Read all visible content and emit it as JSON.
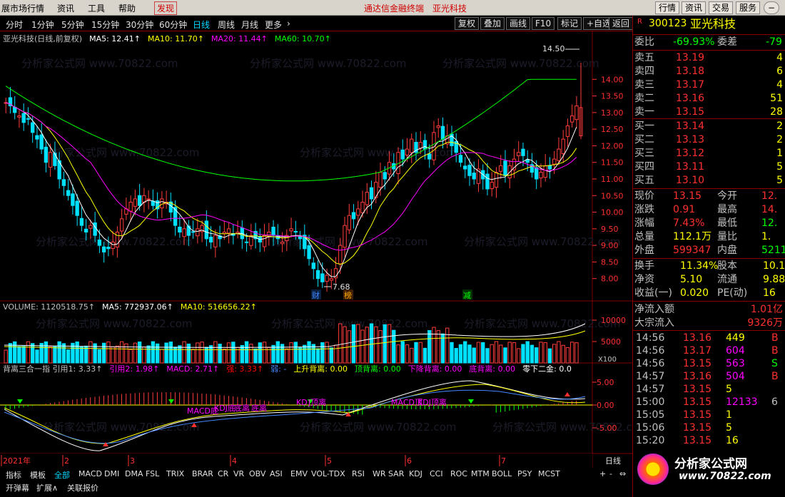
{
  "menu": {
    "items": [
      "展市场行情",
      "资讯",
      "工具",
      "帮助",
      "发现"
    ],
    "center_title": "通达信金融终端",
    "center_stock": "亚光科技",
    "right_buttons": [
      "行情",
      "资讯",
      "交易",
      "服务"
    ]
  },
  "toolbar": {
    "periods": [
      "分时",
      "1分钟",
      "5分钟",
      "15分钟",
      "30分钟",
      "60分钟",
      "日线",
      "周线",
      "月线",
      "更多"
    ],
    "active_period": "日线",
    "buttons": [
      "复权",
      "叠加",
      "画线",
      "F10",
      "标记",
      "+自选",
      "返回"
    ]
  },
  "main": {
    "legend": [
      {
        "text": "亚光科技(日线,前复权)",
        "color": "#c0c0c0"
      },
      {
        "text": "MA5: 12.41↑",
        "color": "#ffffff"
      },
      {
        "text": "MA10: 11.70↑",
        "color": "#ffff00"
      },
      {
        "text": "MA20: 11.44↑",
        "color": "#ff00ff"
      },
      {
        "text": "MA60: 10.70↑",
        "color": "#00ff00"
      }
    ],
    "high_label": "14.50",
    "low_label": "7.68",
    "yticks": [
      "14.00",
      "13.50",
      "13.00",
      "12.50",
      "12.00",
      "11.50",
      "11.00",
      "10.50",
      "10.00",
      "9.50",
      "9.00",
      "8.50",
      "8.00"
    ],
    "markers": [
      "财",
      "榜",
      "减"
    ],
    "watermark": "分析家公式网 www.70822.com"
  },
  "volume": {
    "legend": [
      {
        "text": "VOLUME: 1120518.75↑",
        "color": "#c0c0c0"
      },
      {
        "text": "MA5: 772937.06↑",
        "color": "#ffffff"
      },
      {
        "text": "MA10: 516656.22↑",
        "color": "#ffff00"
      }
    ],
    "yticks": [
      "10000",
      "5000"
    ],
    "unit": "X100"
  },
  "indicator": {
    "legend": [
      {
        "text": "背离三合一指 引用1: 3.33↑",
        "color": "#c0c0c0"
      },
      {
        "text": "引用2: 1.98↑",
        "color": "#ff00ff"
      },
      {
        "text": "MACD: 2.71↑",
        "color": "#ff00ff"
      },
      {
        "text": "强: 3.33↑",
        "color": "#ff0000"
      },
      {
        "text": "弱: -",
        "color": "#4488ff"
      },
      {
        "text": "上升背离: 0.00",
        "color": "#ffff00"
      },
      {
        "text": "顶背离: 0.00",
        "color": "#00ff00"
      },
      {
        "text": "下降背离: 0.00",
        "color": "#ff00ff"
      },
      {
        "text": "底背离: 0.00",
        "color": "#ff00ff"
      },
      {
        "text": "零下二金: 0.0",
        "color": "#ffffff"
      }
    ],
    "yticks": [
      "5.00",
      "0.00",
      "-5.00"
    ],
    "annotations": [
      "MACD底",
      "KDJ底",
      "底离",
      "底离",
      "KD",
      "J顶离",
      "MACD顶",
      "KDJ顶离"
    ]
  },
  "timeline": {
    "labels": [
      "2021年",
      "2",
      "3",
      "4",
      "5",
      "6",
      "7"
    ],
    "period": "日线"
  },
  "bottom": {
    "tabs": [
      "指标",
      "模板",
      "全部",
      "MACD",
      "DMI",
      "DMA",
      "FSL",
      "TRIX",
      "BRAR",
      "CR",
      "VR",
      "OBV",
      "ASI",
      "EMV",
      "VOL-TDX",
      "RSI",
      "WR",
      "SAR",
      "KDJ",
      "CCI",
      "ROC",
      "MTM",
      "BOLL",
      "PSY",
      "MCST"
    ],
    "tabs2": [
      "开弹幕",
      "扩展∧",
      "关联报价"
    ]
  },
  "quote": {
    "code": "300123",
    "name": "亚光科技",
    "wb_label": "委比",
    "wb_value": "-69.93%",
    "wc_label": "委差",
    "wc_value": "-79",
    "asks": [
      {
        "label": "卖五",
        "price": "13.19",
        "vol": "4"
      },
      {
        "label": "卖四",
        "price": "13.18",
        "vol": "6"
      },
      {
        "label": "卖三",
        "price": "13.17",
        "vol": "4"
      },
      {
        "label": "卖二",
        "price": "13.16",
        "vol": "51"
      },
      {
        "label": "卖一",
        "price": "13.15",
        "vol": "28"
      }
    ],
    "bids": [
      {
        "label": "买一",
        "price": "13.14",
        "vol": "2"
      },
      {
        "label": "买二",
        "price": "13.13",
        "vol": "2"
      },
      {
        "label": "买三",
        "price": "13.12",
        "vol": "1"
      },
      {
        "label": "买四",
        "price": "13.11",
        "vol": "5"
      },
      {
        "label": "买五",
        "price": "13.10",
        "vol": "5"
      }
    ],
    "stats": [
      {
        "l": "现价",
        "v": "13.15",
        "vc": "#ff3030",
        "l2": "今开",
        "v2": "12.",
        "v2c": "#ff3030"
      },
      {
        "l": "涨跌",
        "v": "0.91",
        "vc": "#ff3030",
        "l2": "最高",
        "v2": "14.",
        "v2c": "#ff3030"
      },
      {
        "l": "涨幅",
        "v": "7.43%",
        "vc": "#ff3030",
        "l2": "最低",
        "v2": "12.",
        "v2c": "#00ff00"
      },
      {
        "l": "总量",
        "v": "112.1万",
        "vc": "#ffff00",
        "l2": "量比",
        "v2": "1.",
        "v2c": "#ffff00"
      },
      {
        "l": "外盘",
        "v": "599347",
        "vc": "#ff3030",
        "l2": "内盘",
        "v2": "5211",
        "v2c": "#00ff00"
      }
    ],
    "stats2": [
      {
        "l": "换手",
        "v": "11.34%",
        "vc": "#ffff00",
        "l2": "股本",
        "v2": "10.1",
        "v2c": "#ffff00"
      },
      {
        "l": "净资",
        "v": "5.10",
        "vc": "#ffff00",
        "l2": "流通",
        "v2": "9.88",
        "v2c": "#ffff00"
      },
      {
        "l": "收益(一)",
        "v": "0.020",
        "vc": "#ffff00",
        "l2": "PE(动)",
        "v2": "16",
        "v2c": "#ffff00"
      }
    ],
    "flow": [
      {
        "l": "净流入额",
        "v": "1.01亿"
      },
      {
        "l": "大宗流入",
        "v": "9326万"
      }
    ],
    "ticks": [
      {
        "t": "14:56",
        "p": "13.16",
        "pc": "#ff3030",
        "v": "449",
        "vc": "#ffff00",
        "f": "B",
        "fc": "#ff3030"
      },
      {
        "t": "14:56",
        "p": "13.17",
        "pc": "#ff3030",
        "v": "604",
        "vc": "#ff00ff",
        "f": "B",
        "fc": "#ff3030"
      },
      {
        "t": "14:56",
        "p": "13.15",
        "pc": "#ff3030",
        "v": "563",
        "vc": "#ff00ff",
        "f": "S",
        "fc": "#00ff00"
      },
      {
        "t": "14:57",
        "p": "13.16",
        "pc": "#ff3030",
        "v": "504",
        "vc": "#ff00ff",
        "f": "B",
        "fc": "#ff3030"
      },
      {
        "t": "14:57",
        "p": "13.15",
        "pc": "#ff3030",
        "v": "5",
        "vc": "#ffff00",
        "f": "",
        "fc": "#c0c0c0"
      },
      {
        "t": "15:00",
        "p": "13.15",
        "pc": "#ff3030",
        "v": "12133",
        "vc": "#ff00ff",
        "f": "6",
        "fc": "#c0c0c0"
      },
      {
        "t": "15:05",
        "p": "13.15",
        "pc": "#ff3030",
        "v": "1",
        "vc": "#ffff00",
        "f": "",
        "fc": "#c0c0c0"
      },
      {
        "t": "15:06",
        "p": "13.15",
        "pc": "#ff3030",
        "v": "5",
        "vc": "#ffff00",
        "f": "",
        "fc": "#c0c0c0"
      },
      {
        "t": "15:20",
        "p": "13.15",
        "pc": "#ff3030",
        "v": "16",
        "vc": "#ffff00",
        "f": "",
        "fc": "#c0c0c0"
      }
    ],
    "logo_text": "分析家公式网",
    "logo_url": "www.70822.com"
  },
  "chart_data": {
    "type": "candlestick",
    "price_range": [
      7.5,
      14.7
    ],
    "ohlc": [],
    "note": ""
  }
}
